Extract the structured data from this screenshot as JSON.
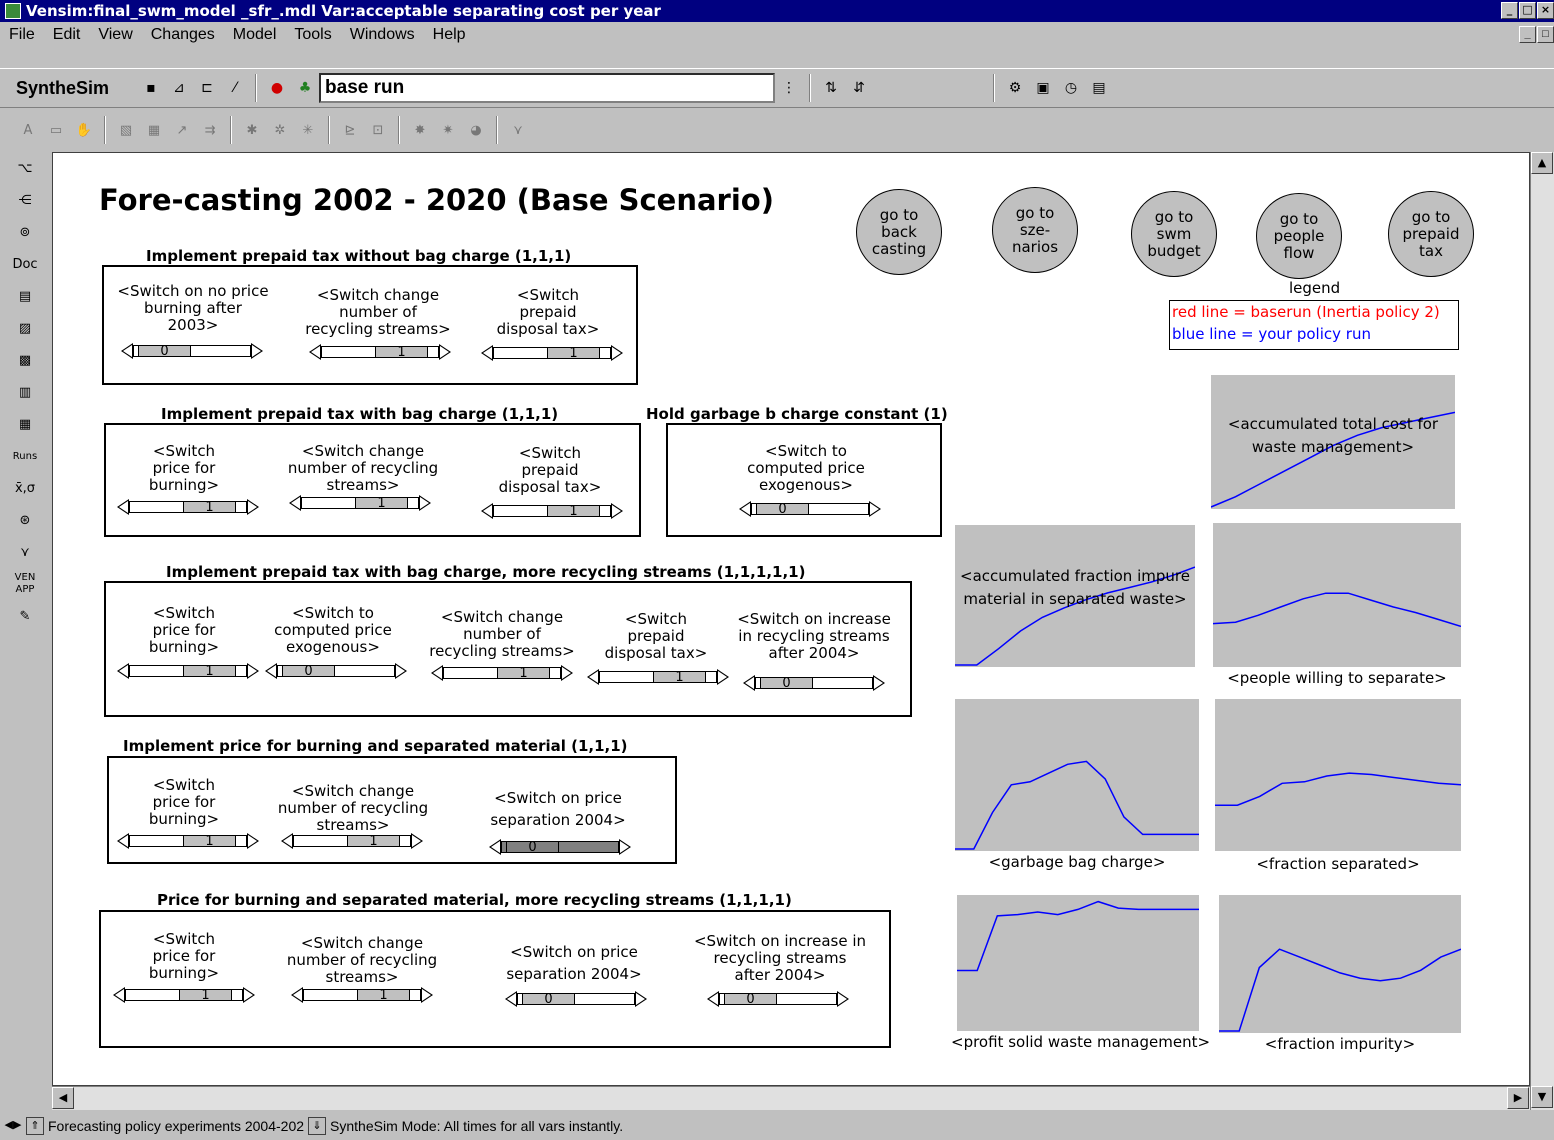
{
  "window": {
    "title": "Vensim:final_swm_model _sfr_.mdl Var:acceptable separating cost per year"
  },
  "menu": [
    "File",
    "Edit",
    "View",
    "Changes",
    "Model",
    "Tools",
    "Windows",
    "Help"
  ],
  "toolbar": {
    "mode_label": "SyntheSim",
    "run_name": "base run"
  },
  "sidebar": [
    "Doc",
    "Runs",
    "x̄,σ",
    "VEN APP"
  ],
  "page": {
    "title": "Fore-casting 2002 - 2020 (Base Scenario)"
  },
  "nav_buttons": [
    {
      "label": "go to\nback\ncasting"
    },
    {
      "label": "go to\nsze-\nnarios"
    },
    {
      "label": "go to\nswm\nbudget"
    },
    {
      "label": "go to\npeople\nflow"
    },
    {
      "label": "go to\nprepaid\ntax"
    }
  ],
  "legend": {
    "title": "legend",
    "red_line": "red line = baserun (Inertia policy 2)",
    "blue_line": "blue line = your policy run",
    "red_color": "#ff0000",
    "blue_color": "#0000ff"
  },
  "groups": [
    {
      "heading": "Implement prepaid tax without bag charge  (1,1,1)",
      "switches": [
        {
          "label": "<Switch on no price\nburning after\n2003>",
          "value": "0"
        },
        {
          "label": "<Switch change\nnumber of\nrecycling streams>",
          "value": "1"
        },
        {
          "label": "<Switch\nprepaid\ndisposal tax>",
          "value": "1"
        }
      ]
    },
    {
      "heading": "Implement prepaid tax with bag charge  (1,1,1)",
      "switches": [
        {
          "label": "<Switch\nprice for\nburning>",
          "value": "1"
        },
        {
          "label": "<Switch change\nnumber of recycling\nstreams>",
          "value": "1"
        },
        {
          "label": "<Switch\nprepaid\ndisposal tax>",
          "value": "1"
        }
      ]
    },
    {
      "heading": "Hold garbage b charge constant  (1)",
      "switches": [
        {
          "label": "<Switch to\ncomputed price\nexogenous>",
          "value": "0"
        }
      ]
    },
    {
      "heading": "Implement prepaid tax with bag charge, more recycling streams  (1,1,1,1,1)",
      "switches": [
        {
          "label": "<Switch\nprice for\nburning>",
          "value": "1"
        },
        {
          "label": "<Switch to\ncomputed price\nexogenous>",
          "value": "0"
        },
        {
          "label": "<Switch change\nnumber of\nrecycling streams>",
          "value": "1"
        },
        {
          "label": "<Switch\nprepaid\ndisposal tax>",
          "value": "1"
        },
        {
          "label": "<Switch on increase\nin recycling streams\nafter 2004>",
          "value": "0"
        }
      ]
    },
    {
      "heading": "Implement price for burning and separated material  (1,1,1)",
      "switches": [
        {
          "label": "<Switch\nprice for\nburning>",
          "value": "1"
        },
        {
          "label": "<Switch change\nnumber of recycling\nstreams>",
          "value": "1"
        },
        {
          "label": "<Switch on price\nseparation 2004>",
          "value": "0"
        }
      ]
    },
    {
      "heading": "Price for burning and separated material, more recycling streams  (1,1,1,1)",
      "switches": [
        {
          "label": "<Switch\nprice for\nburning>",
          "value": "1"
        },
        {
          "label": "<Switch change\nnumber of recycling\nstreams>",
          "value": "1"
        },
        {
          "label": "<Switch on price\nseparation 2004>",
          "value": "0"
        },
        {
          "label": "<Switch on increase in\nrecycling streams\nafter 2004>",
          "value": "0"
        }
      ]
    }
  ],
  "graphs": [
    {
      "label": "<accumulated total cost for\nwaste management>",
      "label_inside": true,
      "shape": [
        0.0,
        0.08,
        0.18,
        0.28,
        0.38,
        0.48,
        0.56,
        0.62,
        0.66,
        0.7,
        0.74
      ]
    },
    {
      "label": "<accumulated fraction impure\nmaterial in separated waste>",
      "label_inside": true,
      "shape": [
        0.0,
        0.0,
        0.12,
        0.25,
        0.35,
        0.42,
        0.48,
        0.53,
        0.57,
        0.61,
        0.66,
        0.72
      ]
    },
    {
      "label": "<people willing to separate>",
      "label_inside": false,
      "shape": [
        0.3,
        0.31,
        0.36,
        0.42,
        0.48,
        0.52,
        0.52,
        0.47,
        0.42,
        0.38,
        0.33,
        0.28
      ]
    },
    {
      "label": "<garbage bag charge>",
      "label_inside": false,
      "shape": [
        0.0,
        0.0,
        0.25,
        0.44,
        0.46,
        0.52,
        0.58,
        0.6,
        0.48,
        0.22,
        0.1,
        0.1,
        0.1,
        0.1
      ]
    },
    {
      "label": "<fraction separated>",
      "label_inside": false,
      "shape": [
        0.3,
        0.3,
        0.36,
        0.45,
        0.46,
        0.5,
        0.52,
        0.51,
        0.49,
        0.47,
        0.45,
        0.44
      ]
    },
    {
      "label": "<profit solid waste management>",
      "label_inside": false,
      "shape": [
        0.45,
        0.45,
        0.87,
        0.88,
        0.9,
        0.88,
        0.92,
        0.98,
        0.93,
        0.92,
        0.92,
        0.92,
        0.92
      ]
    },
    {
      "label": "<fraction impurity>",
      "label_inside": false,
      "shape": [
        0.0,
        0.0,
        0.48,
        0.62,
        0.56,
        0.5,
        0.44,
        0.4,
        0.38,
        0.4,
        0.46,
        0.56,
        0.62
      ]
    }
  ],
  "status": {
    "view_name": "Forecasting policy experiments 2004-202",
    "mode_text": "SyntheSim Mode: All times for all vars instantly."
  }
}
